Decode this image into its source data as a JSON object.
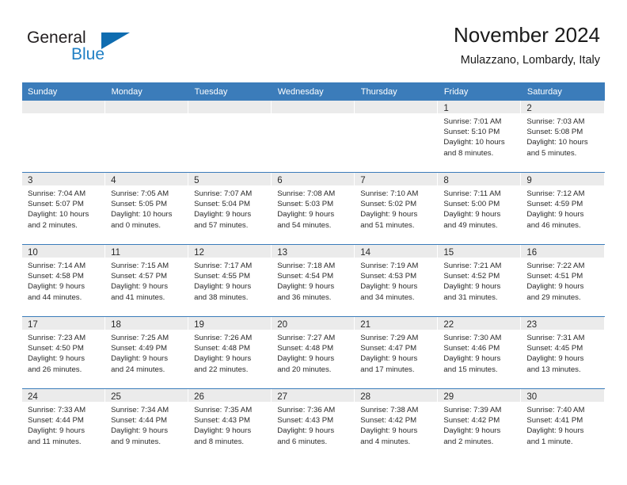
{
  "brand": {
    "name_part1": "General",
    "name_part2": "Blue",
    "triangle_color": "#0f6cb0",
    "blue_text_color": "#1f7fc4"
  },
  "header": {
    "title": "November 2024",
    "location": "Mulazzano, Lombardy, Italy"
  },
  "theme": {
    "header_row_bg": "#3b7cba",
    "daynum_band_bg": "#ebebeb",
    "row_divider": "#3b7cba",
    "page_bg": "#ffffff",
    "text": "#2a2a2a"
  },
  "weekday_headers": [
    "Sunday",
    "Monday",
    "Tuesday",
    "Wednesday",
    "Thursday",
    "Friday",
    "Saturday"
  ],
  "weeks": [
    [
      {
        "day": "",
        "empty": true,
        "sunrise": "",
        "sunset": "",
        "daylight_line1": "",
        "daylight_line2": ""
      },
      {
        "day": "",
        "empty": true,
        "sunrise": "",
        "sunset": "",
        "daylight_line1": "",
        "daylight_line2": ""
      },
      {
        "day": "",
        "empty": true,
        "sunrise": "",
        "sunset": "",
        "daylight_line1": "",
        "daylight_line2": ""
      },
      {
        "day": "",
        "empty": true,
        "sunrise": "",
        "sunset": "",
        "daylight_line1": "",
        "daylight_line2": ""
      },
      {
        "day": "",
        "empty": true,
        "sunrise": "",
        "sunset": "",
        "daylight_line1": "",
        "daylight_line2": ""
      },
      {
        "day": "1",
        "empty": false,
        "sunrise": "Sunrise: 7:01 AM",
        "sunset": "Sunset: 5:10 PM",
        "daylight_line1": "Daylight: 10 hours",
        "daylight_line2": "and 8 minutes."
      },
      {
        "day": "2",
        "empty": false,
        "sunrise": "Sunrise: 7:03 AM",
        "sunset": "Sunset: 5:08 PM",
        "daylight_line1": "Daylight: 10 hours",
        "daylight_line2": "and 5 minutes."
      }
    ],
    [
      {
        "day": "3",
        "empty": false,
        "sunrise": "Sunrise: 7:04 AM",
        "sunset": "Sunset: 5:07 PM",
        "daylight_line1": "Daylight: 10 hours",
        "daylight_line2": "and 2 minutes."
      },
      {
        "day": "4",
        "empty": false,
        "sunrise": "Sunrise: 7:05 AM",
        "sunset": "Sunset: 5:05 PM",
        "daylight_line1": "Daylight: 10 hours",
        "daylight_line2": "and 0 minutes."
      },
      {
        "day": "5",
        "empty": false,
        "sunrise": "Sunrise: 7:07 AM",
        "sunset": "Sunset: 5:04 PM",
        "daylight_line1": "Daylight: 9 hours",
        "daylight_line2": "and 57 minutes."
      },
      {
        "day": "6",
        "empty": false,
        "sunrise": "Sunrise: 7:08 AM",
        "sunset": "Sunset: 5:03 PM",
        "daylight_line1": "Daylight: 9 hours",
        "daylight_line2": "and 54 minutes."
      },
      {
        "day": "7",
        "empty": false,
        "sunrise": "Sunrise: 7:10 AM",
        "sunset": "Sunset: 5:02 PM",
        "daylight_line1": "Daylight: 9 hours",
        "daylight_line2": "and 51 minutes."
      },
      {
        "day": "8",
        "empty": false,
        "sunrise": "Sunrise: 7:11 AM",
        "sunset": "Sunset: 5:00 PM",
        "daylight_line1": "Daylight: 9 hours",
        "daylight_line2": "and 49 minutes."
      },
      {
        "day": "9",
        "empty": false,
        "sunrise": "Sunrise: 7:12 AM",
        "sunset": "Sunset: 4:59 PM",
        "daylight_line1": "Daylight: 9 hours",
        "daylight_line2": "and 46 minutes."
      }
    ],
    [
      {
        "day": "10",
        "empty": false,
        "sunrise": "Sunrise: 7:14 AM",
        "sunset": "Sunset: 4:58 PM",
        "daylight_line1": "Daylight: 9 hours",
        "daylight_line2": "and 44 minutes."
      },
      {
        "day": "11",
        "empty": false,
        "sunrise": "Sunrise: 7:15 AM",
        "sunset": "Sunset: 4:57 PM",
        "daylight_line1": "Daylight: 9 hours",
        "daylight_line2": "and 41 minutes."
      },
      {
        "day": "12",
        "empty": false,
        "sunrise": "Sunrise: 7:17 AM",
        "sunset": "Sunset: 4:55 PM",
        "daylight_line1": "Daylight: 9 hours",
        "daylight_line2": "and 38 minutes."
      },
      {
        "day": "13",
        "empty": false,
        "sunrise": "Sunrise: 7:18 AM",
        "sunset": "Sunset: 4:54 PM",
        "daylight_line1": "Daylight: 9 hours",
        "daylight_line2": "and 36 minutes."
      },
      {
        "day": "14",
        "empty": false,
        "sunrise": "Sunrise: 7:19 AM",
        "sunset": "Sunset: 4:53 PM",
        "daylight_line1": "Daylight: 9 hours",
        "daylight_line2": "and 34 minutes."
      },
      {
        "day": "15",
        "empty": false,
        "sunrise": "Sunrise: 7:21 AM",
        "sunset": "Sunset: 4:52 PM",
        "daylight_line1": "Daylight: 9 hours",
        "daylight_line2": "and 31 minutes."
      },
      {
        "day": "16",
        "empty": false,
        "sunrise": "Sunrise: 7:22 AM",
        "sunset": "Sunset: 4:51 PM",
        "daylight_line1": "Daylight: 9 hours",
        "daylight_line2": "and 29 minutes."
      }
    ],
    [
      {
        "day": "17",
        "empty": false,
        "sunrise": "Sunrise: 7:23 AM",
        "sunset": "Sunset: 4:50 PM",
        "daylight_line1": "Daylight: 9 hours",
        "daylight_line2": "and 26 minutes."
      },
      {
        "day": "18",
        "empty": false,
        "sunrise": "Sunrise: 7:25 AM",
        "sunset": "Sunset: 4:49 PM",
        "daylight_line1": "Daylight: 9 hours",
        "daylight_line2": "and 24 minutes."
      },
      {
        "day": "19",
        "empty": false,
        "sunrise": "Sunrise: 7:26 AM",
        "sunset": "Sunset: 4:48 PM",
        "daylight_line1": "Daylight: 9 hours",
        "daylight_line2": "and 22 minutes."
      },
      {
        "day": "20",
        "empty": false,
        "sunrise": "Sunrise: 7:27 AM",
        "sunset": "Sunset: 4:48 PM",
        "daylight_line1": "Daylight: 9 hours",
        "daylight_line2": "and 20 minutes."
      },
      {
        "day": "21",
        "empty": false,
        "sunrise": "Sunrise: 7:29 AM",
        "sunset": "Sunset: 4:47 PM",
        "daylight_line1": "Daylight: 9 hours",
        "daylight_line2": "and 17 minutes."
      },
      {
        "day": "22",
        "empty": false,
        "sunrise": "Sunrise: 7:30 AM",
        "sunset": "Sunset: 4:46 PM",
        "daylight_line1": "Daylight: 9 hours",
        "daylight_line2": "and 15 minutes."
      },
      {
        "day": "23",
        "empty": false,
        "sunrise": "Sunrise: 7:31 AM",
        "sunset": "Sunset: 4:45 PM",
        "daylight_line1": "Daylight: 9 hours",
        "daylight_line2": "and 13 minutes."
      }
    ],
    [
      {
        "day": "24",
        "empty": false,
        "sunrise": "Sunrise: 7:33 AM",
        "sunset": "Sunset: 4:44 PM",
        "daylight_line1": "Daylight: 9 hours",
        "daylight_line2": "and 11 minutes."
      },
      {
        "day": "25",
        "empty": false,
        "sunrise": "Sunrise: 7:34 AM",
        "sunset": "Sunset: 4:44 PM",
        "daylight_line1": "Daylight: 9 hours",
        "daylight_line2": "and 9 minutes."
      },
      {
        "day": "26",
        "empty": false,
        "sunrise": "Sunrise: 7:35 AM",
        "sunset": "Sunset: 4:43 PM",
        "daylight_line1": "Daylight: 9 hours",
        "daylight_line2": "and 8 minutes."
      },
      {
        "day": "27",
        "empty": false,
        "sunrise": "Sunrise: 7:36 AM",
        "sunset": "Sunset: 4:43 PM",
        "daylight_line1": "Daylight: 9 hours",
        "daylight_line2": "and 6 minutes."
      },
      {
        "day": "28",
        "empty": false,
        "sunrise": "Sunrise: 7:38 AM",
        "sunset": "Sunset: 4:42 PM",
        "daylight_line1": "Daylight: 9 hours",
        "daylight_line2": "and 4 minutes."
      },
      {
        "day": "29",
        "empty": false,
        "sunrise": "Sunrise: 7:39 AM",
        "sunset": "Sunset: 4:42 PM",
        "daylight_line1": "Daylight: 9 hours",
        "daylight_line2": "and 2 minutes."
      },
      {
        "day": "30",
        "empty": false,
        "sunrise": "Sunrise: 7:40 AM",
        "sunset": "Sunset: 4:41 PM",
        "daylight_line1": "Daylight: 9 hours",
        "daylight_line2": "and 1 minute."
      }
    ]
  ]
}
